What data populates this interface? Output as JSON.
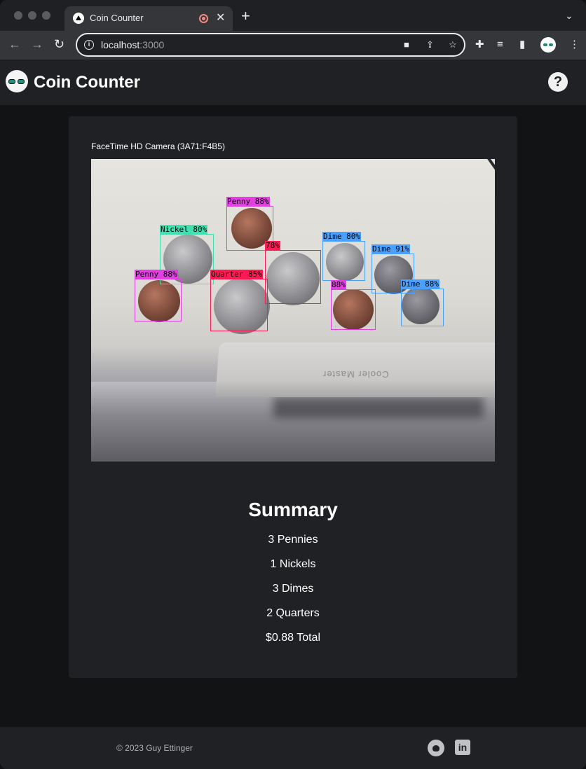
{
  "browser": {
    "tab_title": "Coin Counter",
    "url_host": "localhost",
    "url_port": ":3000",
    "new_tab_symbol": "+",
    "close_symbol": "✕"
  },
  "app": {
    "title": "Coin Counter",
    "help_label": "?"
  },
  "camera": {
    "label": "FaceTime HD Camera (3A71:F4B5)",
    "background_text": "Cooler Master",
    "detections": [
      {
        "label": "Penny 88%",
        "color": "#e040e0"
      },
      {
        "label": "Nickel 80%",
        "color": "#40e0b0"
      },
      {
        "label": "78%",
        "color": "#ff1a55"
      },
      {
        "label": "Dime 80%",
        "color": "#4aa0ff"
      },
      {
        "label": "Dime 91%",
        "color": "#4aa0ff"
      },
      {
        "label": "Penny 88%",
        "color": "#e040e0"
      },
      {
        "label": "Quarter 85%",
        "color": "#ff1a55"
      },
      {
        "label": "88%",
        "color": "#e040e0"
      },
      {
        "label": "Dime 88%",
        "color": "#4aa0ff"
      }
    ]
  },
  "summary": {
    "title": "Summary",
    "pennies": "3 Pennies",
    "nickels": "1 Nickels",
    "dimes": "3 Dimes",
    "quarters": "2 Quarters",
    "total": "$0.88 Total"
  },
  "footer": {
    "copyright": "© 2023 Guy Ettinger",
    "linkedin_text": "in",
    "github_icon": "github-icon",
    "linkedin_icon": "linkedin-icon"
  }
}
